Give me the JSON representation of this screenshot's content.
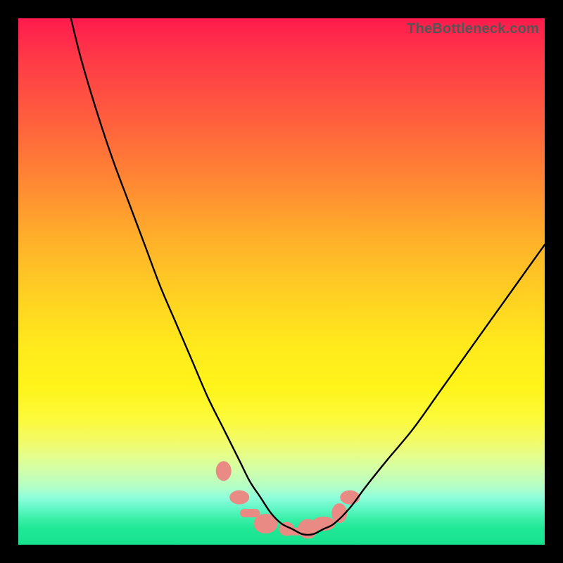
{
  "watermark": "TheBottleneck.com",
  "chart_data": {
    "type": "line",
    "title": "",
    "xlabel": "",
    "ylabel": "",
    "xlim": [
      0,
      100
    ],
    "ylim": [
      0,
      100
    ],
    "series": [
      {
        "name": "bottleneck-curve",
        "x": [
          10,
          12,
          15,
          18,
          21,
          24,
          27,
          30,
          33,
          36,
          39,
          42,
          44,
          46,
          48,
          50,
          52,
          54,
          56,
          58,
          60,
          63,
          66,
          70,
          75,
          80,
          85,
          90,
          95,
          100
        ],
        "values": [
          100,
          92,
          82,
          73,
          65,
          57,
          49,
          42,
          35,
          28,
          22,
          16,
          12,
          9,
          6,
          4,
          3,
          2,
          2,
          3,
          4,
          7,
          11,
          16,
          22,
          29,
          36,
          43,
          50,
          57
        ]
      }
    ],
    "markers": {
      "comment": "salmon rounded blobs near the trough",
      "color": "#e98b84",
      "points": [
        {
          "x": 39,
          "y": 14
        },
        {
          "x": 42,
          "y": 9
        },
        {
          "x": 47,
          "y": 4
        },
        {
          "x": 51,
          "y": 3
        },
        {
          "x": 55,
          "y": 3
        },
        {
          "x": 58,
          "y": 4
        },
        {
          "x": 61,
          "y": 6
        },
        {
          "x": 63,
          "y": 9
        }
      ]
    }
  }
}
